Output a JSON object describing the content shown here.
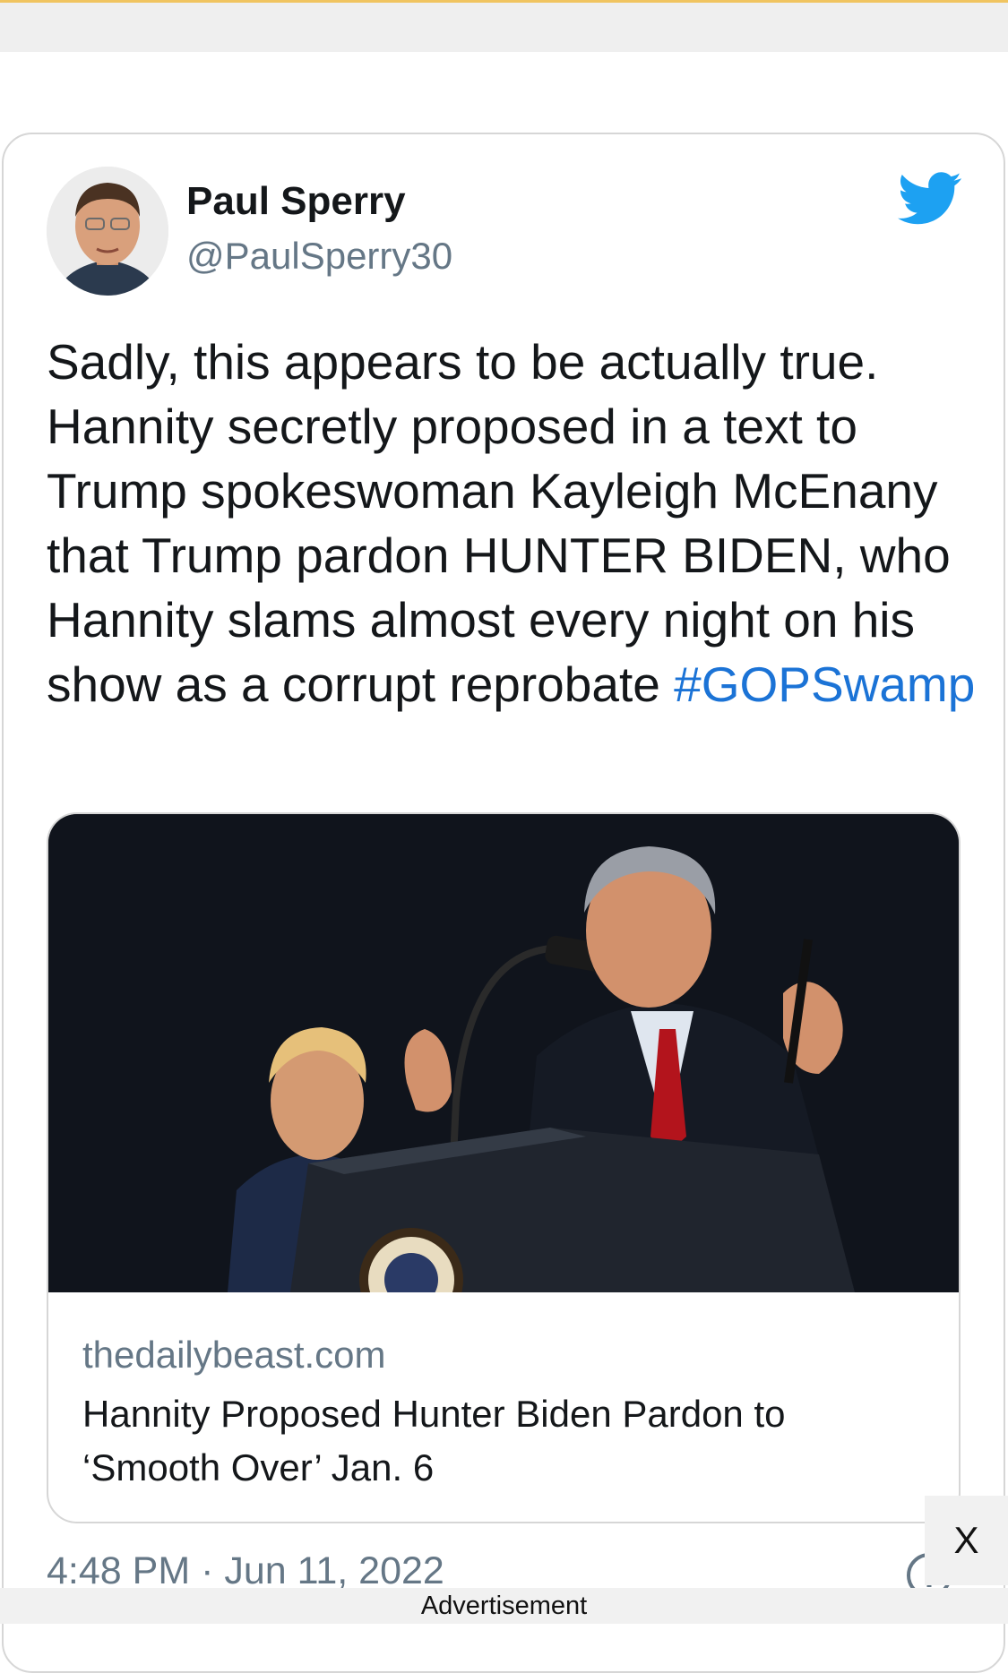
{
  "tweet": {
    "author_name": "Paul Sperry",
    "author_handle": "@PaulSperry30",
    "text": "Sadly, this appears to be actually true. Hannity secretly proposed in a text to Trump spokeswoman Kayleigh McEnany that Trump pardon HUNTER BIDEN, who Hannity slams almost every night on his show as a corrupt reprobate ",
    "hashtag": "#GOPSwamp",
    "timestamp": "4:48 PM · Jun 11, 2022",
    "brand_icon": "twitter-bird-icon",
    "brand_color": "#1da1f2",
    "hashtag_color": "#1b73d6"
  },
  "link_card": {
    "domain": "thedailybeast.com",
    "title": "Hannity Proposed Hunter Biden Pardon to ‘Smooth Over’ Jan. 6"
  },
  "ad": {
    "label": "Advertisement",
    "close_label": "X"
  }
}
